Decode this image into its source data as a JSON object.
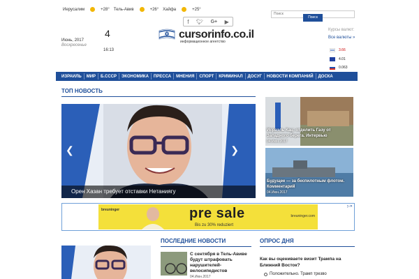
{
  "weather": [
    {
      "city": "Иерусалим",
      "temp": "+28°"
    },
    {
      "city": "Тель-Авив",
      "temp": "+26°"
    },
    {
      "city": "Хайфа",
      "temp": "+25°"
    }
  ],
  "search": {
    "placeholder": "Поиск",
    "button": "Поиск"
  },
  "date": {
    "month_year": "Июнь, 2017",
    "weekday": "Воскресенье",
    "day": "4",
    "time": "16:13"
  },
  "logo": {
    "name": "cursorinfo.co.il",
    "tagline": "информационное агентство"
  },
  "social_icons": [
    "facebook-icon",
    "twitter-icon",
    "google-plus-icon",
    "youtube-icon"
  ],
  "currency": {
    "title": "Курсы валют:",
    "link": "Все валюты »",
    "rates": [
      {
        "flag": "il",
        "value": "3.66"
      },
      {
        "flag": "eu",
        "value": "4.01"
      },
      {
        "flag": "ru",
        "value": "0.063"
      }
    ]
  },
  "nav": [
    "ИЗРАИЛЬ",
    "МИР",
    "Б.СССР",
    "ЭКОНОМИКА",
    "ПРЕССА",
    "МНЕНИЯ",
    "СПОРТ",
    "КРИМИНАЛ",
    "ДОСУГ",
    "НОВОСТИ КОМПАНИЙ",
    "ДОСКА"
  ],
  "top_news": {
    "section_title": "ТОП НОВОСТЬ",
    "caption": "Орен Хазан требует отставки Нетаниягу"
  },
  "side_news": [
    {
      "title": "Исраэль Кац: отделить Газу от Западного берега. Интервью",
      "date": "04.Июн.2017"
    },
    {
      "title": "Будущее — за беспилотным флотом. Комментарий",
      "date": "04.Июн.2017"
    }
  ],
  "banner": {
    "brand": "breuninger",
    "headline": "pre sale",
    "sub": "Bis zu 30% reduziert",
    "site": "breuninger.com"
  },
  "latest": {
    "section_title": "ПОСЛЕДНИЕ НОВОСТИ",
    "items": [
      {
        "title": "С сентября в Тель-Авиве будут штрафовать нарушителей-велосипедистов",
        "date": "04.Июн.2017"
      }
    ]
  },
  "poll": {
    "section_title": "ОПРОС ДНЯ",
    "question": "Как вы оцениваете визит Трампа на Ближний Восток?",
    "options": [
      "Положительно. Трамп трезво"
    ]
  },
  "colors": {
    "brand_blue": "#1f4f9a",
    "banner_yellow": "#f4e03a"
  }
}
